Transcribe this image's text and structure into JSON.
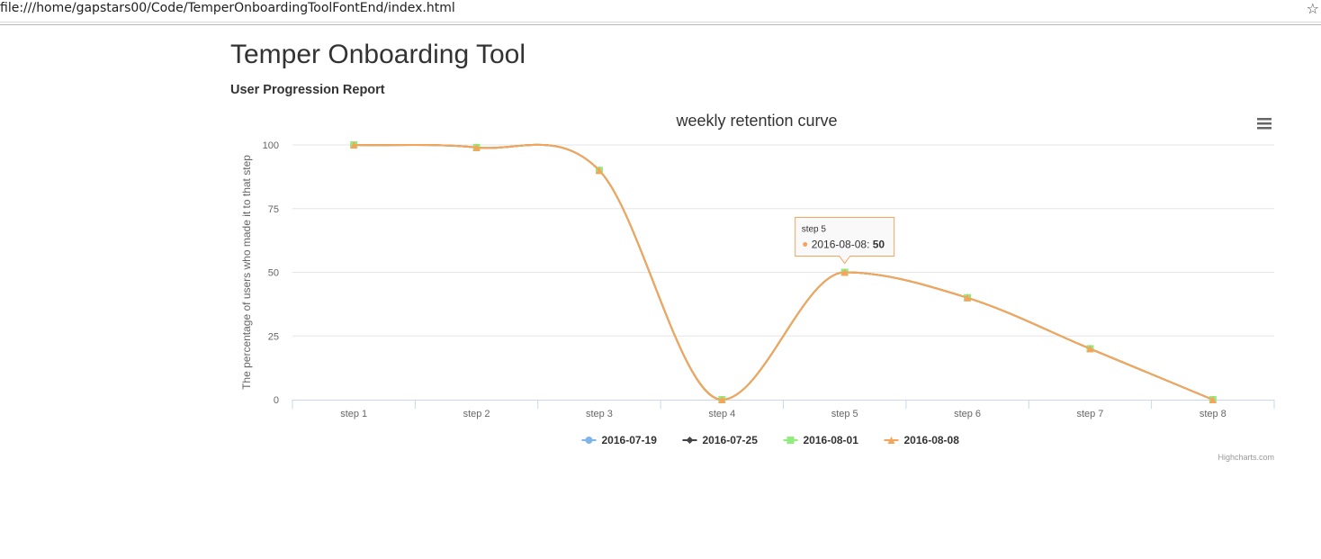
{
  "browser": {
    "url": "file:///home/gapstars00/Code/TemperOnboardingToolFontEnd/index.html",
    "bookmark_icon": "star-icon"
  },
  "page": {
    "title": "Temper Onboarding Tool",
    "subtitle": "User Progression Report"
  },
  "chart_data": {
    "type": "line",
    "title": "weekly retention curve",
    "xlabel": "",
    "ylabel": "The percentage of users who made it to that step",
    "categories": [
      "step 1",
      "step 2",
      "step 3",
      "step 4",
      "step 5",
      "step 6",
      "step 7",
      "step 8"
    ],
    "ylim": [
      0,
      100
    ],
    "yticks": [
      0,
      25,
      50,
      75,
      100
    ],
    "grid": true,
    "legend_placement": "bottom-center",
    "series": [
      {
        "name": "2016-07-19",
        "color": "#7cb5ec",
        "marker": "circle",
        "values": [
          100,
          99,
          90,
          0,
          50,
          40,
          20,
          0
        ]
      },
      {
        "name": "2016-07-25",
        "color": "#434348",
        "marker": "diamond",
        "values": [
          100,
          99,
          90,
          0,
          50,
          40,
          20,
          0
        ]
      },
      {
        "name": "2016-08-01",
        "color": "#90ed7d",
        "marker": "square",
        "values": [
          100,
          99,
          90,
          0,
          50,
          40,
          20,
          0
        ]
      },
      {
        "name": "2016-08-08",
        "color": "#f7a35c",
        "marker": "triangle",
        "values": [
          100,
          99,
          90,
          0,
          50,
          40,
          20,
          0
        ]
      }
    ],
    "tooltip": {
      "header": "step 5",
      "series": "2016-08-08",
      "label": "2016-08-08: ",
      "value": "50",
      "category_index": 4,
      "series_index": 3
    },
    "credits": "Highcharts.com",
    "menu_icon": "hamburger-menu-icon"
  }
}
